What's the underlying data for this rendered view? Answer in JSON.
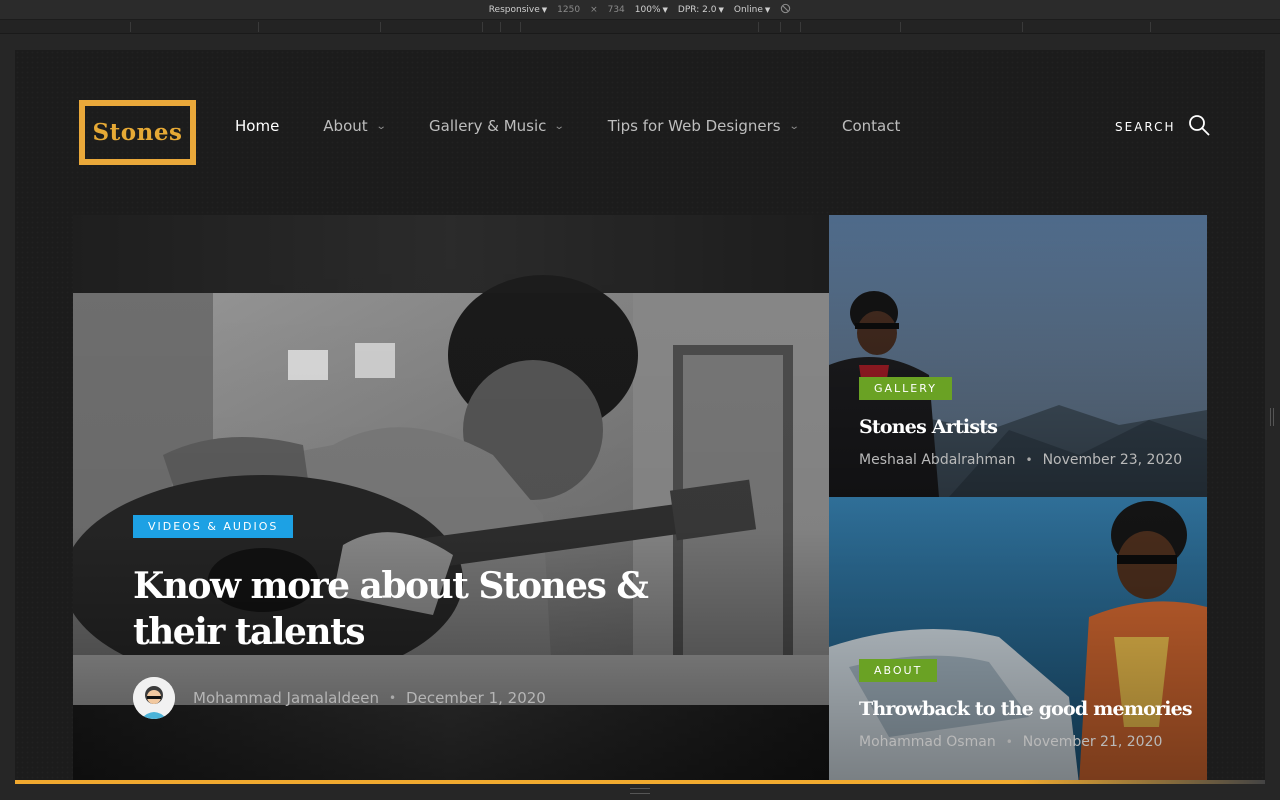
{
  "devtools": {
    "device": "Responsive",
    "width": "1250",
    "times": "×",
    "height": "734",
    "zoom": "100%",
    "dpr": "DPR: 2.0",
    "network": "Online"
  },
  "brand": {
    "logo_text": "Stones",
    "accent": "#e9a83a"
  },
  "nav": {
    "items": [
      {
        "label": "Home",
        "active": true
      },
      {
        "label": "About",
        "dropdown": true
      },
      {
        "label": "Gallery & Music",
        "dropdown": true
      },
      {
        "label": "Tips for Web Designers",
        "dropdown": true
      },
      {
        "label": "Contact"
      }
    ],
    "search_label": "SEARCH"
  },
  "hero": {
    "category": "VIDEOS & AUDIOS",
    "category_color": "#1da1e4",
    "title": "Know more about Stones & their talents",
    "author": "Mohammad Jamalaldeen",
    "separator": "•",
    "date": "December 1, 2020"
  },
  "cards": [
    {
      "category": "GALLERY",
      "category_color": "#6aa224",
      "title": "Stones Artists",
      "author": "Meshaal Abdalrahman",
      "separator": "•",
      "date": "November 23, 2020"
    },
    {
      "category": "ABOUT",
      "category_color": "#6aa224",
      "title": "Throwback to the good memories",
      "author": "Mohammad Osman",
      "separator": "•",
      "date": "November 21, 2020"
    }
  ]
}
